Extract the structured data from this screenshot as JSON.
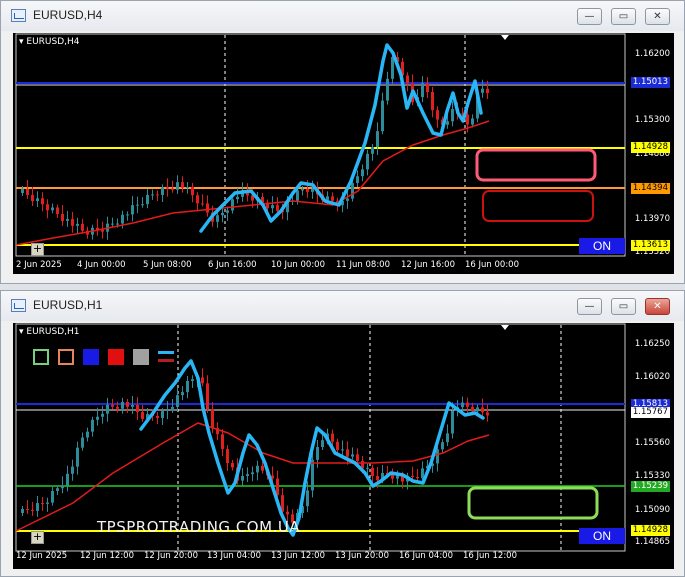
{
  "window1": {
    "title": "EURUSD,H4",
    "chart_title": "EURUSD,H4",
    "price_labels": [
      "1.16200",
      "1.15300",
      "1.14880",
      "1.13970",
      "1.13520"
    ],
    "level_badges": [
      {
        "text": "1.15013",
        "color": "#1b2bd6"
      },
      {
        "text": "1.14928",
        "color": "#ffff00"
      },
      {
        "text": "1.14394",
        "color": "#ff9900"
      },
      {
        "text": "1.13613",
        "color": "#ffff00"
      }
    ],
    "time_labels": [
      "2 Jun 2025",
      "4 Jun 00:00",
      "5 Jun 08:00",
      "6 Jun 16:00",
      "10 Jun 00:00",
      "11 Jun 08:00",
      "12 Jun 16:00",
      "16 Jun 00:00"
    ],
    "on_button": "ON"
  },
  "window2": {
    "title": "EURUSD,H1",
    "chart_title": "EURUSD,H1",
    "price_labels": [
      "1.16250",
      "1.16020",
      "1.15560",
      "1.15330",
      "1.15090",
      "1.14865"
    ],
    "level_badges": [
      {
        "text": "1.15813",
        "color": "#1b2bd6"
      },
      {
        "text": "1.15767",
        "color": "#ffffff"
      },
      {
        "text": "1.15239",
        "color": "#22aa22"
      },
      {
        "text": "1.14928",
        "color": "#ffff00"
      }
    ],
    "time_labels": [
      "12 Jun 2025",
      "12 Jun 12:00",
      "12 Jun 20:00",
      "13 Jun 04:00",
      "13 Jun 12:00",
      "13 Jun 20:00",
      "16 Jun 04:00",
      "16 Jun 12:00"
    ],
    "on_button": "ON",
    "watermark": "TPSPROTRADING.COM.UA"
  },
  "icons": {
    "minimize": "minimize-icon",
    "maximize": "maximize-icon",
    "close": "close-icon",
    "crosshair": "crosshair-icon"
  },
  "colors": {
    "bull": "#2e8b9a",
    "bear": "#e02020",
    "ma": "#e21b1b",
    "trace": "#29b6f6",
    "blue_line": "#1b2bd6",
    "yellow_line": "#ffff00",
    "orange_line": "#ff9933",
    "green_line": "#22cc22"
  }
}
